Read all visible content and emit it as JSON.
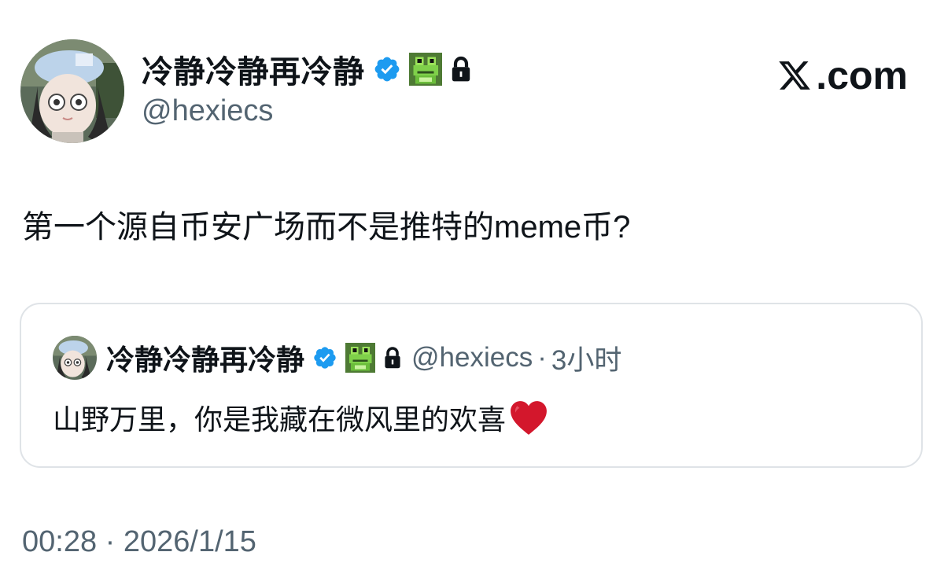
{
  "post": {
    "author": {
      "display_name": "冷静冷静再冷静",
      "handle": "@hexiecs",
      "avatar_icon": "avatar-image",
      "badges": [
        "verified-badge-icon",
        "frog-emoji-icon",
        "lock-icon"
      ]
    },
    "brand": {
      "text": ".com",
      "logo_icon": "x-logo-icon"
    },
    "text": "第一个源自币安广场而不是推特的meme币?",
    "quoted": {
      "display_name": "冷静冷静再冷静",
      "handle": "@hexiecs",
      "separator": "·",
      "time": "3小时",
      "text": "山野万里，你是我藏在微风里的欢喜",
      "trailing_icon": "red-heart-emoji-icon"
    },
    "timestamp": {
      "time": "00:28",
      "separator": "·",
      "date": "2026/1/15"
    }
  },
  "colors": {
    "primary_text": "#0f1419",
    "secondary_text": "#536471",
    "verified_blue": "#1d9bf0",
    "card_border": "#dfe3e7",
    "heart_red": "#d3172c"
  }
}
